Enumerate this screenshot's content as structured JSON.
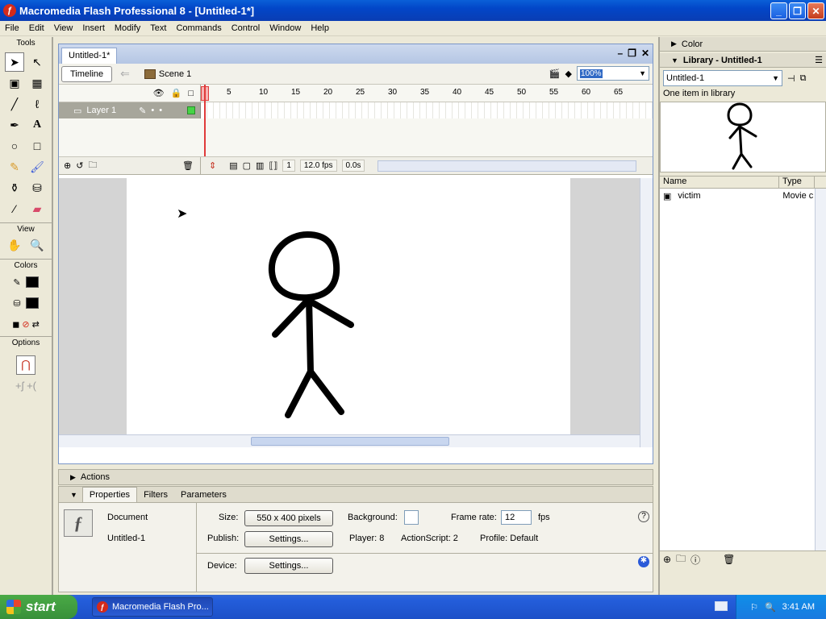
{
  "window": {
    "title": "Macromedia Flash Professional 8 - [Untitled-1*]",
    "min_label": "_",
    "restore_label": "❐",
    "close_label": "✕"
  },
  "menu": [
    "File",
    "Edit",
    "View",
    "Insert",
    "Modify",
    "Text",
    "Commands",
    "Control",
    "Window",
    "Help"
  ],
  "tools": {
    "title": "Tools",
    "view_label": "View",
    "colors_label": "Colors",
    "options_label": "Options"
  },
  "document": {
    "tab": "Untitled-1*",
    "timeline_button": "Timeline",
    "scene": "Scene 1",
    "zoom": "100%"
  },
  "timeline": {
    "ruler": [
      "1",
      "5",
      "10",
      "15",
      "20",
      "25",
      "30",
      "35",
      "40",
      "45",
      "50",
      "55",
      "60",
      "65"
    ],
    "layer_name": "Layer 1",
    "current_frame": "1",
    "fps": "12.0 fps",
    "time": "0.0s"
  },
  "actions_label": "Actions",
  "properties": {
    "tabs": [
      "Properties",
      "Filters",
      "Parameters"
    ],
    "doc_type": "Document",
    "doc_name": "Untitled-1",
    "size_label": "Size:",
    "size_value": "550 x 400 pixels",
    "background_label": "Background:",
    "framerate_label": "Frame rate:",
    "framerate_value": "12",
    "fps_label": "fps",
    "publish_label": "Publish:",
    "settings_label": "Settings...",
    "player": "Player: 8",
    "actionscript": "ActionScript:  2",
    "profile": "Profile:  Default",
    "device_label": "Device:",
    "help_label": "?"
  },
  "panels": {
    "color_label": "Color",
    "library_title": "Library - Untitled-1",
    "library_doc": "Untitled-1",
    "item_count": "One item in library",
    "col_name": "Name",
    "col_type": "Type",
    "items": [
      {
        "name": "victim",
        "type": "Movie c"
      }
    ]
  },
  "taskbar": {
    "start": "start",
    "task": "Macromedia Flash Pro...",
    "clock": "3:41 AM"
  }
}
